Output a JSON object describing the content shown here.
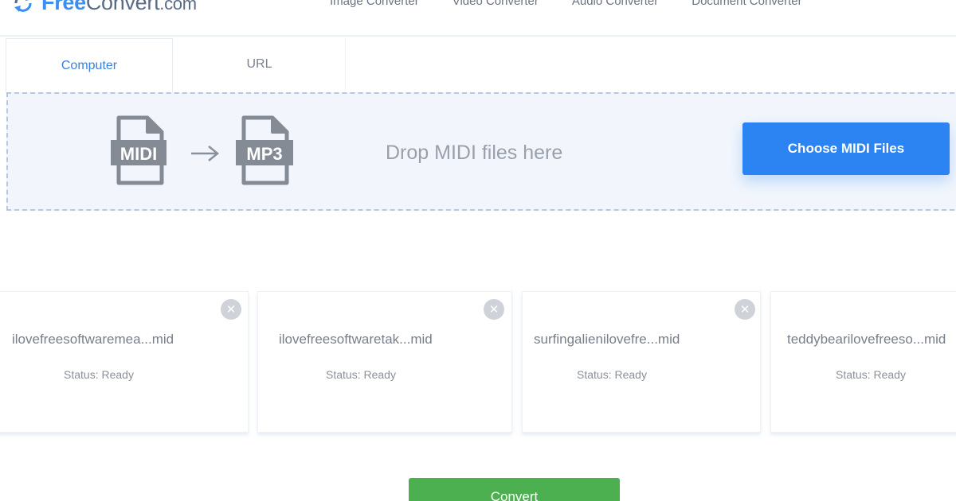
{
  "header": {
    "logo": {
      "free": "Free",
      "convert": "Convert",
      "com": ".com"
    },
    "nav": [
      "Image Converter",
      "Video Converter",
      "Audio Converter",
      "Document Converter"
    ]
  },
  "tabs": {
    "computer": "Computer",
    "url": "URL"
  },
  "dropzone": {
    "from_label": "MIDI",
    "to_label": "MP3",
    "drop_text": "Drop MIDI files here",
    "choose_button": "Choose MIDI Files"
  },
  "files": [
    {
      "name": "ilovefreesoftwaremea...mid",
      "status": "Status: Ready"
    },
    {
      "name": "ilovefreesoftwaretak...mid",
      "status": "Status: Ready"
    },
    {
      "name": "surfingalienilovefre...mid",
      "status": "Status: Ready"
    },
    {
      "name": "teddybearilovefreeso...mid",
      "status": "Status: Ready"
    }
  ],
  "convert_button": "Convert",
  "colors": {
    "accent": "#2b84f2",
    "convert": "#4caf50",
    "tab_active": "#3a82de"
  }
}
